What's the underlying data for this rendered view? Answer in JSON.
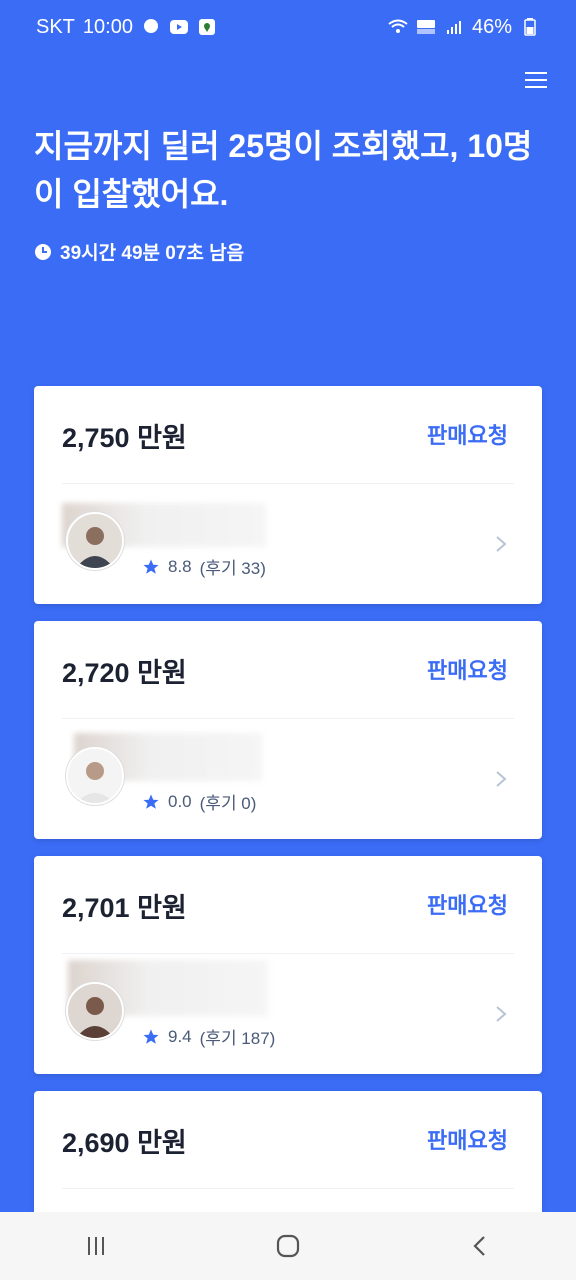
{
  "status_bar": {
    "carrier": "SKT",
    "time": "10:00",
    "battery": "46%"
  },
  "header": {
    "headline": "지금까지 딜러 25명이 조회했고, 10명이 입찰했어요.",
    "timer": "39시간 49분 07초 남음"
  },
  "bids": [
    {
      "price": "2,750",
      "unit": "만원",
      "action": "판매요청",
      "rating": "8.8",
      "reviews": "(후기 33)"
    },
    {
      "price": "2,720",
      "unit": "만원",
      "action": "판매요청",
      "rating": "0.0",
      "reviews": "(후기 0)"
    },
    {
      "price": "2,701",
      "unit": "만원",
      "action": "판매요청",
      "rating": "9.4",
      "reviews": "(후기 187)"
    },
    {
      "price": "2,690",
      "unit": "만원",
      "action": "판매요청"
    }
  ],
  "colors": {
    "brand_blue": "#3b6cf6",
    "star": "#3b6cf6"
  },
  "icons": {
    "menu": "hamburger-icon",
    "clock": "clock-icon",
    "star": "star-icon",
    "chevron": "chevron-right-icon"
  }
}
